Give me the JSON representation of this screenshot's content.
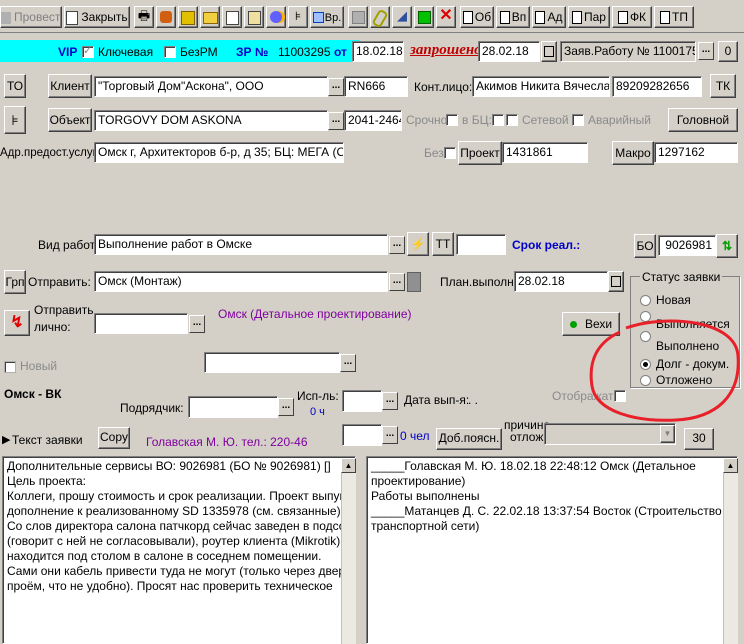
{
  "toolbar": {
    "conduct_label": "Провести",
    "close_label": "Закрыть",
    "vr_label": "Вр.",
    "ob_label": "Об",
    "vn_label": "Вп",
    "ad_label": "Ад",
    "par_label": "Пар",
    "fk_label": "ФК",
    "tp_label": "ТП"
  },
  "header": {
    "vip_label": "VIP",
    "key_label": "Ключевая",
    "bezrm_label": "БезРМ",
    "zr_label": "ЗР №",
    "zr_number": "11003295",
    "from_label": "от",
    "date": "18.02.18",
    "status_text": "запрошено",
    "status_date": "28.02.18",
    "work_request": "Заяв.Работу № 11001758",
    "zero_label": "0"
  },
  "client_row": {
    "to_label": "ТО",
    "client_button": "Клиент",
    "client_name": "\"Торговый Дом\"Аскона\", ООО",
    "client_code": "RN666",
    "contact_label": "Конт.лицо:",
    "contact_name": "Акимов Никита Вячеславі",
    "phone": "89209282656",
    "tk_label": "ТК"
  },
  "object_row": {
    "object_button": "Объект",
    "object_name": "TORGOVY DOM ASKONA",
    "object_code": "2041-2464",
    "urgent_label": "Срочно",
    "in_bc_label": "в БЦ:",
    "network_label": "Сетевой",
    "emergency_label": "Аварийный",
    "head_button": "Головной"
  },
  "address_row": {
    "label": "Адр.предост.услуг:",
    "address": "Омск г, Архитекторов б-р, д 35; БЦ: МЕГА (Омск)",
    "bez_label": "Без",
    "project_button": "Проект",
    "project_number": "1431861",
    "macro_button": "Макро",
    "macro_number": "1297162"
  },
  "work_row": {
    "label": "Вид работ:",
    "value": "Выполнение работ в Омске",
    "tt_label": "ТТ",
    "deadline_label": "Срок реал.:",
    "bo_button": "БО",
    "bo_number": "9026981"
  },
  "send_row": {
    "grp_button": "Грп",
    "send_label": "Отправить:",
    "send_value": "Омск (Монтаж)",
    "plan_label": "План.выполн.:",
    "plan_date": "28.02.18"
  },
  "personal_row": {
    "label_line1": "Отправить",
    "label_line2": "лично:",
    "dept_text": "Омск (Детальное проектирование)",
    "milestones_button": "Вехи"
  },
  "status_group": {
    "title": "Статус заявки",
    "options": [
      "Новая",
      "Выполняется",
      "Выполнено",
      "Долг - докум.",
      "Отложено"
    ],
    "selected": "Долг - докум."
  },
  "new_row": {
    "new_label": "Новый"
  },
  "contractor_row": {
    "region": "Омск - ВК",
    "contractor_label": "Подрядчик:",
    "executor_label": "Исп-ль:",
    "hours_label": "0 ч",
    "date_done_label": "Дата вып-я:",
    "date_done_value": ". .",
    "display_label": "Отображать"
  },
  "text_row": {
    "text_label": "Текст заявки",
    "copy_button": "Copy",
    "author": "Голавская М. Ю. тел.: 220-46",
    "people": "0 чел",
    "add_expl_button": "Доб.поясн.",
    "reason_line1": "причина",
    "reason_line2": "отлож.",
    "thirty_button": "30"
  },
  "left_text": [
    "Дополнительные сервисы ВО: 9026981 (БО № 9026981) []",
    "Цель проекта:",
    "Коллеги, прошу стоимость и срок реализации. Проект выпущен в",
    "дополнение к реализованному SD 1335978 (см. связанные).",
    "Со слов директора салона патчкорд сейчас заведен в подсобку",
    "(говорит с ней не согласовывали), роутер клиента (Mikrotik)",
    "находится под столом в салоне в соседнем помещении.",
    "Сами они кабель привести туда не могут (только через дверной",
    "проём, что не удобно). Просят нас проверить техническое"
  ],
  "right_text": [
    "_____Голавская М. Ю. 18.02.18 22:48:12 Омск (Детальное",
    "проектирование)",
    "Работы выполнены",
    "_____Матанцев Д. С. 22.02.18 13:37:54 Восток (Строительство",
    "транспортной сети)"
  ],
  "colors": {
    "vip_blue": "#0000c8",
    "status_red": "#c00000",
    "dept_purple": "#8000a0",
    "annotation_red": "#e8202a",
    "highlight_cyan": "#00ffff"
  }
}
